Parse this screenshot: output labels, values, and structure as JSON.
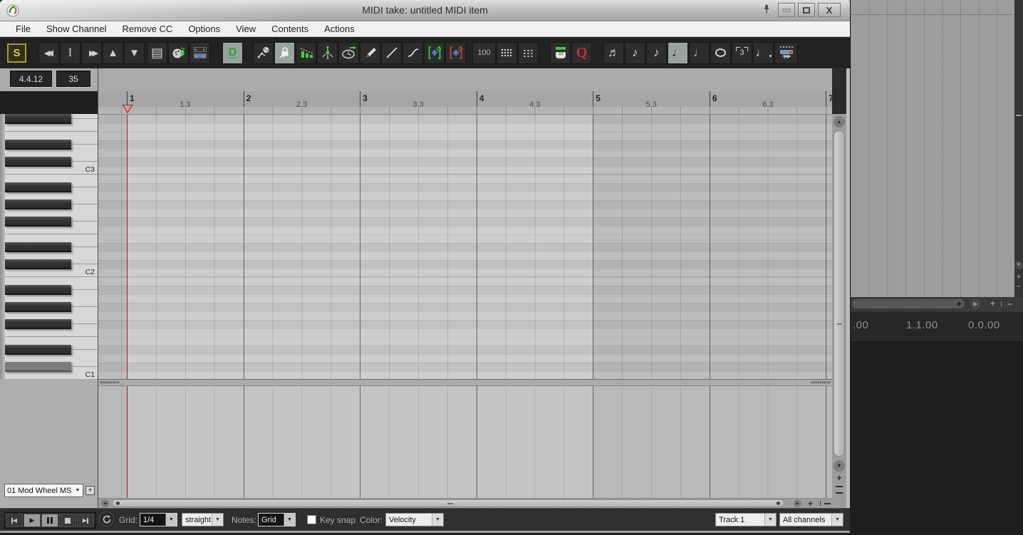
{
  "window": {
    "title": "MIDI take: untitled MIDI item",
    "controls": [
      "pin",
      "minimize",
      "maximize",
      "close"
    ]
  },
  "menu": {
    "items": [
      "File",
      "Show Channel",
      "Remove CC",
      "Options",
      "View",
      "Contents",
      "Actions"
    ]
  },
  "toolbar": {
    "s_label": "S",
    "quantize_strength": "100",
    "q_label": "Q",
    "triplet_label": "3",
    "step_insert_label": "+▶▶",
    "notes": {
      "sixteenth": "♬",
      "eighth": "♪",
      "eighth2": "♪",
      "quarter": "♩",
      "half": "♩",
      "dotted": "♩"
    },
    "icon_names": [
      "s-mode",
      "step-back",
      "insert-cursor",
      "step-forward",
      "move-up",
      "move-down",
      "event-list",
      "color-palette",
      "cc-lane-combo",
      "dock",
      "select-cc-events",
      "cc-edit-lock",
      "cc-ramp-bars",
      "spread-events",
      "time-clock",
      "pencil-tool",
      "line-tool",
      "curve-tool",
      "linear-ramp-cc",
      "curved-ramp-cc",
      "quantize-strength",
      "grid-dots",
      "swing-dots",
      "velocity-hand",
      "quantize",
      "note-sixteenth",
      "note-eighth",
      "note-eighth-alt",
      "note-quarter",
      "note-half",
      "note-whole",
      "note-triplet",
      "note-dotted",
      "step-insert"
    ]
  },
  "position": {
    "bar_beat": "4.4.12",
    "value": "35"
  },
  "ruler": {
    "measures": [
      {
        "label": "1",
        "sub": "1.3"
      },
      {
        "label": "2",
        "sub": "2.3"
      },
      {
        "label": "3",
        "sub": "3.3"
      },
      {
        "label": "4",
        "sub": "4.3"
      },
      {
        "label": "5",
        "sub": "5.3"
      },
      {
        "label": "6",
        "sub": "6.3"
      },
      {
        "label": "7",
        "sub": ""
      }
    ]
  },
  "piano": {
    "octave_labels": [
      {
        "label": "C3",
        "row": 6
      },
      {
        "label": "C2",
        "row": 18
      },
      {
        "label": "C1",
        "row": 30
      }
    ]
  },
  "cc_lane": {
    "selector_value": "01 Mod Wheel MS",
    "add_label": "+"
  },
  "bottom": {
    "grid_label": "Grid:",
    "grid_value": "1/4",
    "swing_value": "straight",
    "notes_label": "Notes:",
    "notes_value": "Grid",
    "key_snap_label": "Key snap",
    "color_label": "Color:",
    "color_value": "Velocity",
    "track_value": "Track 1",
    "channels_value": "All channels"
  },
  "background": {
    "times": [
      ".00",
      "1.1.00",
      "0.0.00"
    ]
  },
  "colors": {
    "accent_green": "#3fd23f",
    "cursor_red": "#9e2222",
    "s_yellow": "#ddca42",
    "q_red": "#c23030",
    "diamond_blue": "#4a78c8",
    "item_bg": "#cdcdcd",
    "grid_bg": "#bdbdbd"
  }
}
